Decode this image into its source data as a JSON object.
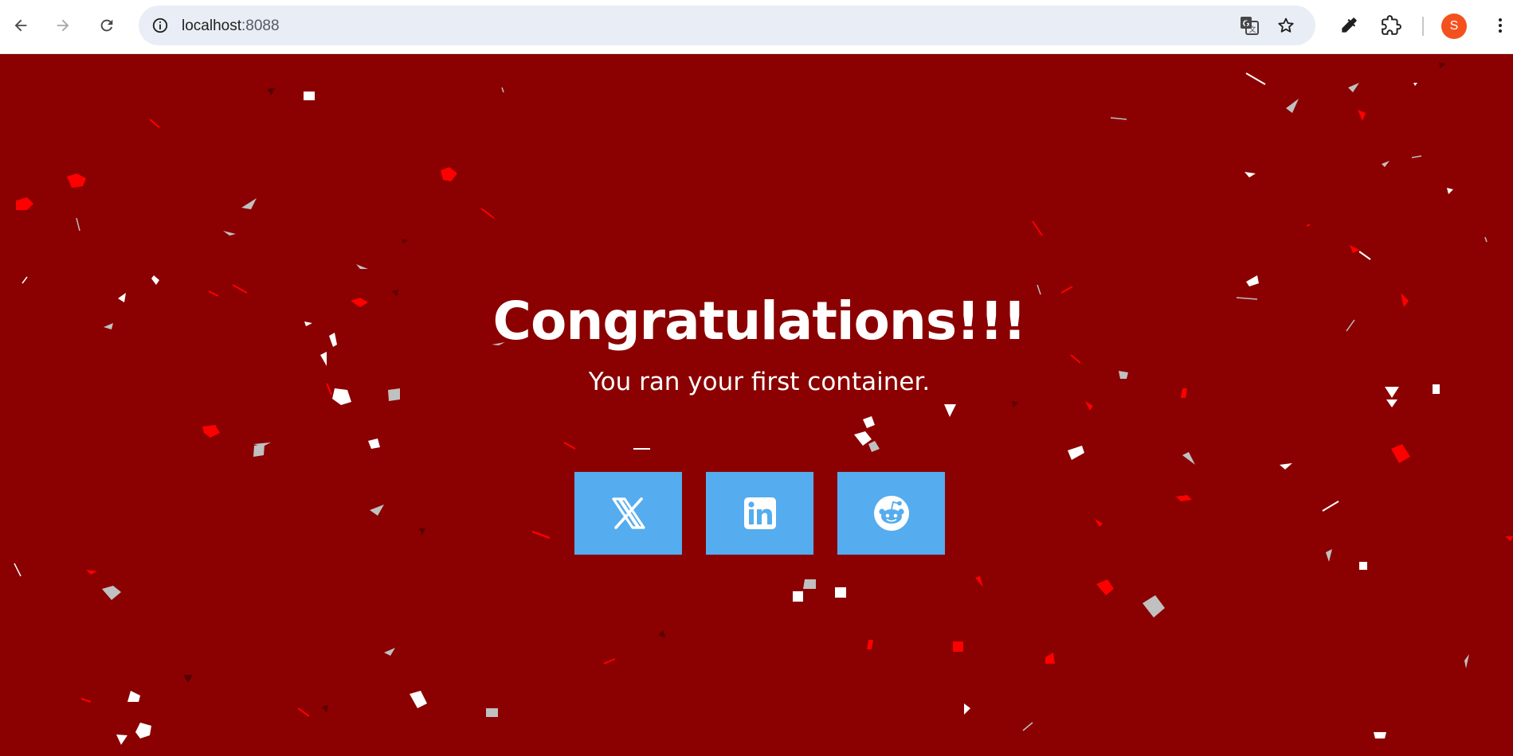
{
  "browser": {
    "url_host": "localhost",
    "url_port": ":8088",
    "profile_initial": "S",
    "icons": [
      "back-icon",
      "forward-icon",
      "reload-icon",
      "site-info-icon",
      "translate-icon",
      "bookmark-star-icon",
      "eyedropper-icon",
      "extensions-icon",
      "more-vert-icon"
    ]
  },
  "page": {
    "title": "Congratulations!!!",
    "subtitle": "You ran your first container.",
    "share_buttons": [
      {
        "icon": "x-twitter-icon"
      },
      {
        "icon": "linkedin-icon"
      },
      {
        "icon": "reddit-icon"
      }
    ]
  },
  "colors": {
    "background": "#8b0000",
    "button": "#55acee",
    "confetti": [
      "#ffffff",
      "#c0c0c0",
      "#ff0000"
    ]
  }
}
